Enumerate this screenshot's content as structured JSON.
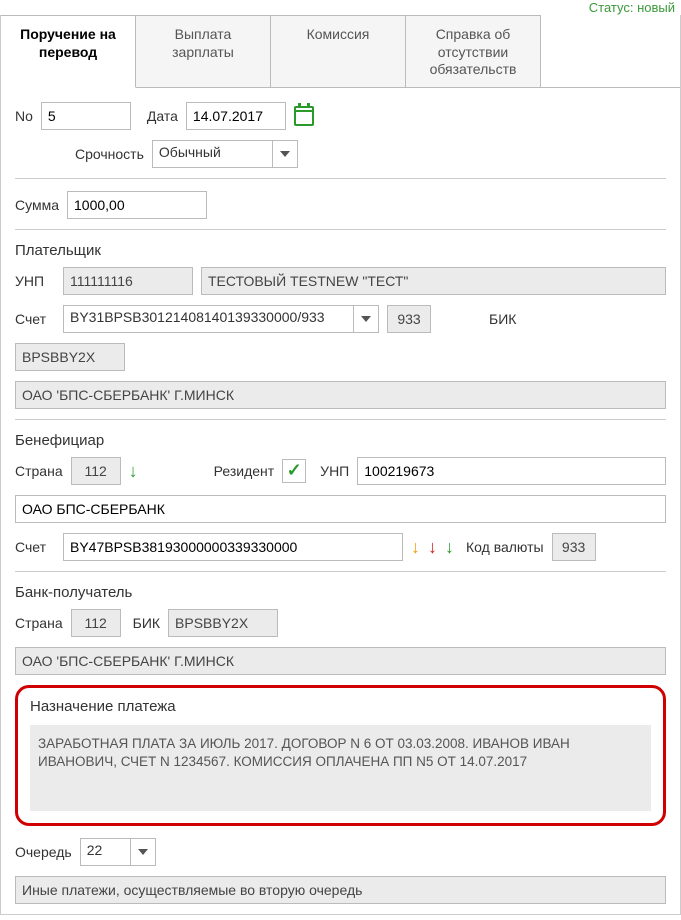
{
  "status": "Статус: новый",
  "tabs": [
    "Поручение на перевод",
    "Выплата зарплаты",
    "Комиссия",
    "Справка об отсутствии обязательств"
  ],
  "doc": {
    "no_label": "No",
    "no": "5",
    "date_label": "Дата",
    "date": "14.07.2017",
    "urgency_label": "Срочность",
    "urgency": "Обычный",
    "sum_label": "Сумма",
    "sum": "1000,00"
  },
  "payer": {
    "title": "Плательщик",
    "unp_label": "УНП",
    "unp": "111111116",
    "name": "ТЕСТОВЫЙ TESTNEW \"ТЕСТ\"",
    "acct_label": "Счет",
    "acct": "BY31BPSB30121408140139330000/933",
    "code": "933",
    "bic_label": "БИК",
    "bic": "BPSBBY2X",
    "bank": "ОАО 'БПС-СБЕРБАНК' Г.МИНСК"
  },
  "benef": {
    "title": "Бенефициар",
    "country_label": "Страна",
    "country": "112",
    "resident_label": "Резидент",
    "unp_label": "УНП",
    "unp": "100219673",
    "name": "ОАО БПС-СБЕРБАНК",
    "acct_label": "Счет",
    "acct": "BY47BPSB38193000000339330000",
    "currency_label": "Код валюты",
    "currency": "933"
  },
  "recv_bank": {
    "title": "Банк-получатель",
    "country_label": "Страна",
    "country": "112",
    "bic_label": "БИК",
    "bic": "BPSBBY2X",
    "bank": "ОАО 'БПС-СБЕРБАНК' Г.МИНСК"
  },
  "purpose": {
    "title": "Назначение платежа",
    "text": "ЗАРАБОТНАЯ ПЛАТА ЗА ИЮЛЬ 2017. ДОГОВОР N 6 ОТ 03.03.2008. ИВАНОВ ИВАН ИВАНОВИЧ, СЧЕТ N 1234567. КОМИССИЯ ОПЛАЧЕНА ПП N5 ОТ 14.07.2017"
  },
  "queue": {
    "label": "Очередь",
    "value": "22",
    "other": "Иные платежи, осуществляемые во вторую очередь"
  }
}
